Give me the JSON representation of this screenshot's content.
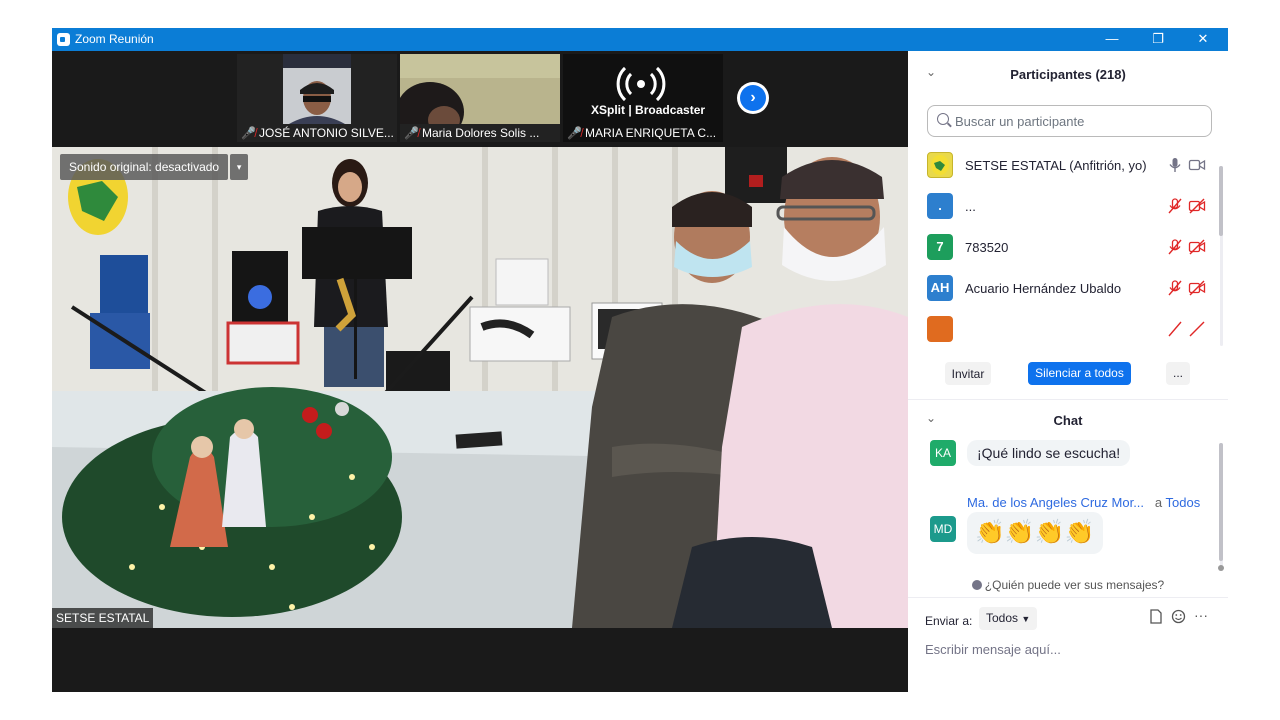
{
  "window": {
    "title": "Zoom Reunión",
    "minimize_glyph": "—",
    "restore_glyph": "❐",
    "close_glyph": "✕"
  },
  "thumbnails": [
    {
      "name": "JOSÉ ANTONIO SILVE...",
      "mic": "muted"
    },
    {
      "name": "Maria Dolores Solis ...",
      "mic": "muted"
    },
    {
      "name": "MARIA ENRIQUETA C...",
      "mic": "muted"
    }
  ],
  "thumb_logo": {
    "brand": "XSplit | Broadcaster"
  },
  "main_video": {
    "audio_label": "Sonido original: desactivado",
    "speaker_name": "SETSE ESTATAL"
  },
  "participants": {
    "header": "Participantes (218)",
    "search_placeholder": "Buscar un participante",
    "list": [
      {
        "initials": "",
        "name": "SETSE ESTATAL (Anfitrión, yo)",
        "avatar_color": "#e9d94a",
        "mic": "on",
        "video": "on"
      },
      {
        "initials": ".",
        "name": "...",
        "avatar_color": "#2d7fce",
        "mic": "muted",
        "video": "off"
      },
      {
        "initials": "7",
        "name": "783520",
        "avatar_color": "#1d9e5c",
        "mic": "muted",
        "video": "off"
      },
      {
        "initials": "AH",
        "name": "Acuario Hernández Ubaldo",
        "avatar_color": "#2d7fce",
        "mic": "muted",
        "video": "off"
      },
      {
        "initials": "",
        "name": "",
        "avatar_color": "#e06b1f",
        "mic": "muted",
        "video": "off"
      }
    ],
    "invite_label": "Invitar",
    "mute_all_label": "Silenciar a todos",
    "more_label": "..."
  },
  "chat": {
    "header": "Chat",
    "messages": [
      {
        "initials": "KA",
        "avatar_color": "#1fab6a",
        "text": "¡Qué lindo se escucha!"
      },
      {
        "initials": "MD",
        "avatar_color": "#1c9a8c",
        "sender": "Ma. de los Angeles Cruz Mor...",
        "to_prefix": "a",
        "to": "Todos",
        "text": "👏👏👏👏"
      }
    ],
    "who_sees": "¿Quién puede ver sus mensajes?",
    "send_to_label": "Enviar a:",
    "send_to_value": "Todos",
    "input_placeholder": "Escribir mensaje aquí..."
  }
}
